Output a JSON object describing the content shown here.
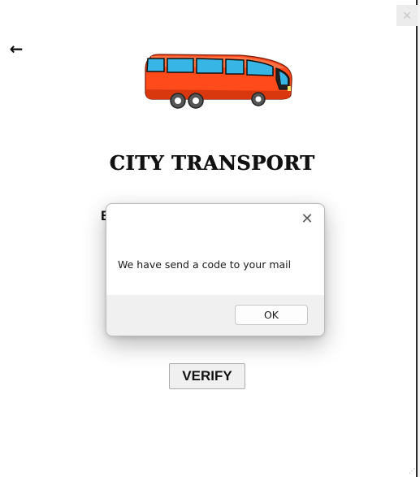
{
  "window": {
    "close_glyph": "✕"
  },
  "header": {
    "back_glyph": "←",
    "logo_icon": "bus-icon",
    "title": "CITY TRANSPORT"
  },
  "form": {
    "partial_label": "E",
    "verify_label": "VERIFY"
  },
  "dialog": {
    "close_glyph": "✕",
    "message": "We have send a code to your mail",
    "ok_label": "OK"
  },
  "colors": {
    "bus_body": "#ff4a1c",
    "bus_window": "#37b6e6",
    "dialog_footer": "#f0f0f0"
  }
}
